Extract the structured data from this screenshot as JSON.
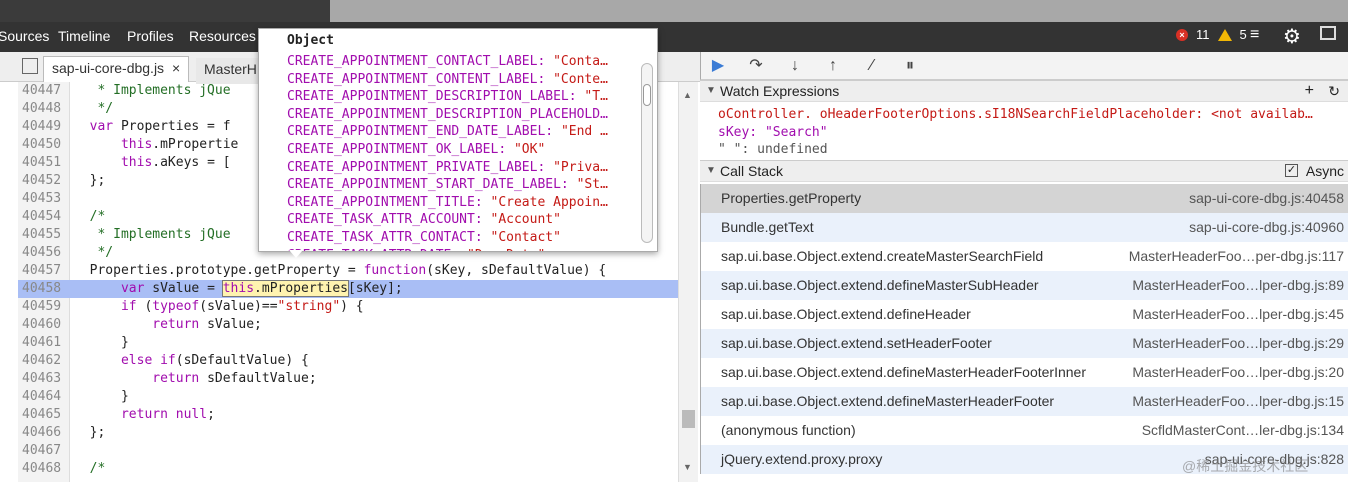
{
  "top_nav": {
    "items": [
      "Sources",
      "Timeline",
      "Profiles",
      "Resources"
    ],
    "errors_count": "11",
    "warnings_count": "5"
  },
  "file_tabs": {
    "active": "sap-ui-core-dbg.js",
    "close_glyph": "×",
    "inactive": "MasterH"
  },
  "source": {
    "lines": [
      {
        "n": "40447",
        "t": "   * Implements jQue"
      },
      {
        "n": "40448",
        "t": "   */"
      },
      {
        "n": "40449",
        "t": "  var Properties = f"
      },
      {
        "n": "40450",
        "t": "      this.mPropertie"
      },
      {
        "n": "40451",
        "t": "      this.aKeys = ["
      },
      {
        "n": "40452",
        "t": "  };"
      },
      {
        "n": "40453",
        "t": ""
      },
      {
        "n": "40454",
        "t": "  /*"
      },
      {
        "n": "40455",
        "t": "   * Implements jQue"
      },
      {
        "n": "40456",
        "t": "   */"
      },
      {
        "n": "40457",
        "t": "  Properties.prototype.getProperty = function(sKey, sDefaultValue) {"
      },
      {
        "n": "40458",
        "t": "      var sValue = this.mProperties[sKey];"
      },
      {
        "n": "40459",
        "t": "      if (typeof(sValue)==\"string\") {"
      },
      {
        "n": "40460",
        "t": "          return sValue;"
      },
      {
        "n": "40461",
        "t": "      }"
      },
      {
        "n": "40462",
        "t": "      else if(sDefaultValue) {"
      },
      {
        "n": "40463",
        "t": "          return sDefaultValue;"
      },
      {
        "n": "40464",
        "t": "      }"
      },
      {
        "n": "40465",
        "t": "      return null;"
      },
      {
        "n": "40466",
        "t": "  };"
      },
      {
        "n": "40467",
        "t": ""
      },
      {
        "n": "40468",
        "t": "  /*"
      }
    ]
  },
  "popover": {
    "title": "Object",
    "rows": [
      {
        "k": "CREATE_APPOINTMENT_CONTACT_LABEL: ",
        "v": "\"Conta…"
      },
      {
        "k": "CREATE_APPOINTMENT_CONTENT_LABEL: ",
        "v": "\"Conte…"
      },
      {
        "k": "CREATE_APPOINTMENT_DESCRIPTION_LABEL: ",
        "v": "\"T…"
      },
      {
        "k": "CREATE_APPOINTMENT_DESCRIPTION_PLACEHOLD…",
        "v": ""
      },
      {
        "k": "CREATE_APPOINTMENT_END_DATE_LABEL: ",
        "v": "\"End …"
      },
      {
        "k": "CREATE_APPOINTMENT_OK_LABEL: ",
        "v": "\"OK\""
      },
      {
        "k": "CREATE_APPOINTMENT_PRIVATE_LABEL: ",
        "v": "\"Priva…"
      },
      {
        "k": "CREATE_APPOINTMENT_START_DATE_LABEL: ",
        "v": "\"St…"
      },
      {
        "k": "CREATE_APPOINTMENT_TITLE: ",
        "v": "\"Create Appoin…"
      },
      {
        "k": "CREATE_TASK_ATTR_ACCOUNT: ",
        "v": "\"Account\""
      },
      {
        "k": "CREATE_TASK_ATTR_CONTACT: ",
        "v": "\"Contact\""
      },
      {
        "k": "CREATE_TASK_ATTR_DATE: ",
        "v": "\"Due Date\""
      }
    ]
  },
  "watch": {
    "title": "Watch Expressions",
    "lines": [
      {
        "text": "oController. oHeaderFooterOptions.sI18NSearchFieldPlaceholder: <not availab…",
        "color": "#c41a16"
      },
      {
        "text": "sKey: \"Search\"",
        "color": "#a10dae"
      },
      {
        "text": "\" \": undefined",
        "color": "#555555"
      }
    ]
  },
  "call_stack": {
    "title": "Call Stack",
    "async_label": "Async",
    "frames": [
      {
        "fn": "Properties.getProperty",
        "loc": "sap-ui-core-dbg.js:40458"
      },
      {
        "fn": "Bundle.getText",
        "loc": "sap-ui-core-dbg.js:40960"
      },
      {
        "fn": "sap.ui.base.Object.extend.createMasterSearchField",
        "loc": "MasterHeaderFoo…per-dbg.js:117"
      },
      {
        "fn": "sap.ui.base.Object.extend.defineMasterSubHeader",
        "loc": "MasterHeaderFoo…lper-dbg.js:89"
      },
      {
        "fn": "sap.ui.base.Object.extend.defineHeader",
        "loc": "MasterHeaderFoo…lper-dbg.js:45"
      },
      {
        "fn": "sap.ui.base.Object.extend.setHeaderFooter",
        "loc": "MasterHeaderFoo…lper-dbg.js:29"
      },
      {
        "fn": "sap.ui.base.Object.extend.defineMasterHeaderFooterInner",
        "loc": "MasterHeaderFoo…lper-dbg.js:20"
      },
      {
        "fn": "sap.ui.base.Object.extend.defineMasterHeaderFooter",
        "loc": "MasterHeaderFoo…lper-dbg.js:15"
      },
      {
        "fn": "(anonymous function)",
        "loc": "ScfldMasterCont…ler-dbg.js:134"
      },
      {
        "fn": "jQuery.extend.proxy.proxy",
        "loc": "sap-ui-core-dbg.js:828"
      }
    ]
  },
  "watermark": "@稀土掘金技术社区"
}
